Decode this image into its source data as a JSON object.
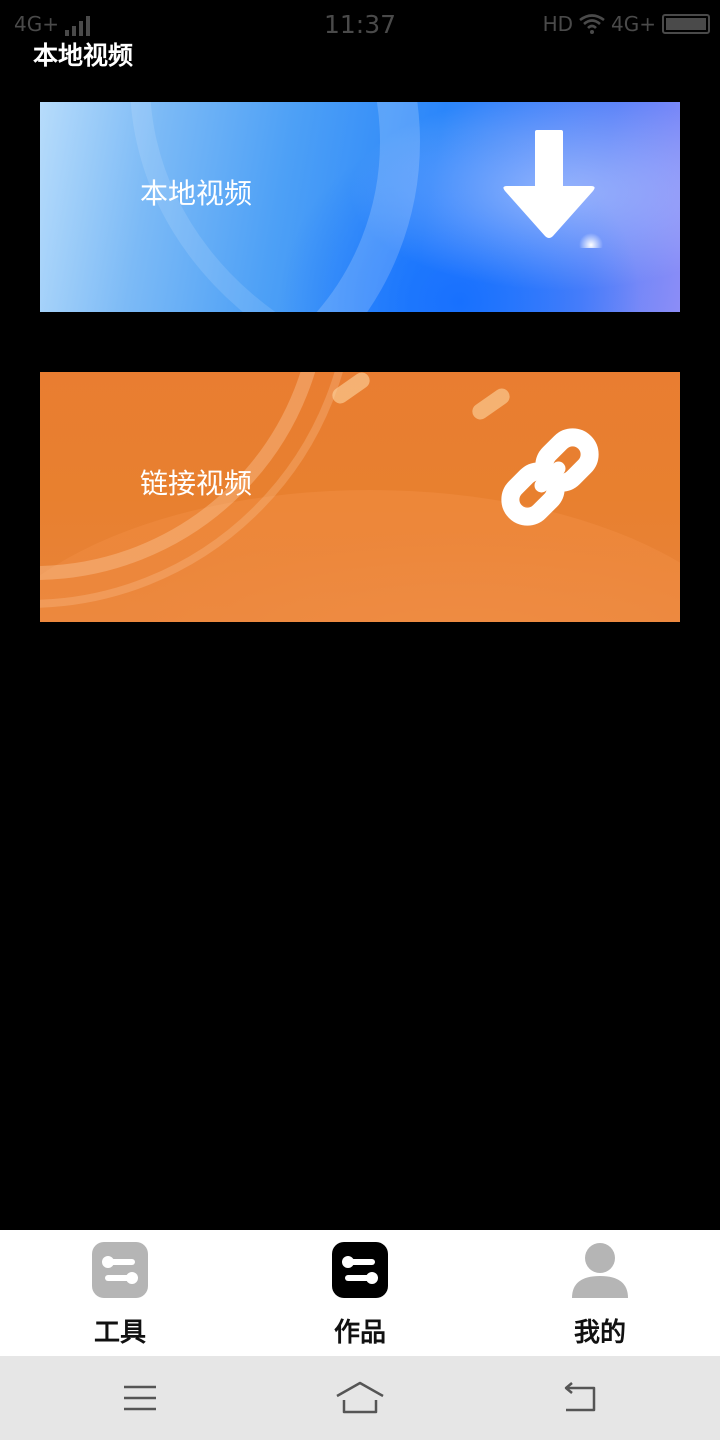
{
  "status_bar": {
    "left_network": "4G+",
    "time": "11:37",
    "right_hd": "HD",
    "right_network": "4G+"
  },
  "page_title": "本地视频",
  "cards": [
    {
      "label": "本地视频",
      "icon": "download-arrow-icon",
      "accent": "#2b86fa"
    },
    {
      "label": "链接视频",
      "icon": "link-icon",
      "accent": "#e8802f"
    }
  ],
  "bottom_nav": {
    "items": [
      {
        "label": "工具",
        "icon": "tools-icon",
        "state": "inactive"
      },
      {
        "label": "作品",
        "icon": "works-icon",
        "state": "active"
      },
      {
        "label": "我的",
        "icon": "profile-icon",
        "state": "inactive"
      }
    ]
  },
  "system_nav": {
    "buttons": [
      "menu-icon",
      "home-icon",
      "back-icon"
    ]
  }
}
